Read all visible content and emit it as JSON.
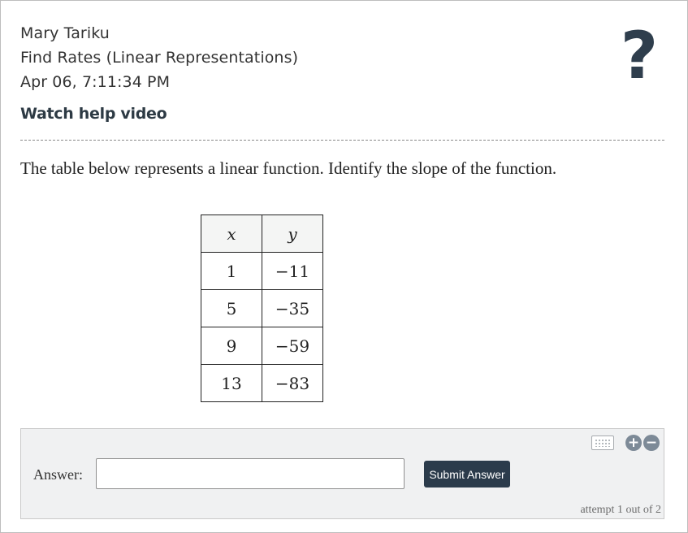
{
  "header": {
    "student_name": "Mary Tariku",
    "assignment_title": "Find Rates (Linear Representations)",
    "timestamp": "Apr 06, 7:11:34 PM",
    "help_video_label": "Watch help video",
    "help_icon_glyph": "?"
  },
  "question": {
    "prompt": "The table below represents a linear function. Identify the slope of the function.",
    "table": {
      "headers": [
        "x",
        "y"
      ],
      "rows": [
        [
          "1",
          "−11"
        ],
        [
          "5",
          "−35"
        ],
        [
          "9",
          "−59"
        ],
        [
          "13",
          "−83"
        ]
      ]
    }
  },
  "answer": {
    "label": "Answer:",
    "value": "",
    "placeholder": "",
    "submit_label": "Submit Answer",
    "attempt_text": "attempt 1 out of 2"
  },
  "tools": {
    "keyboard_icon": "keyboard-icon",
    "zoom_in_glyph": "+",
    "zoom_out_glyph": "−"
  },
  "colors": {
    "accent": "#2b3b4b",
    "panel_bg": "#f0f1f2",
    "table_header_bg": "#f4f5f4",
    "icon_gray": "#7d8a97"
  }
}
